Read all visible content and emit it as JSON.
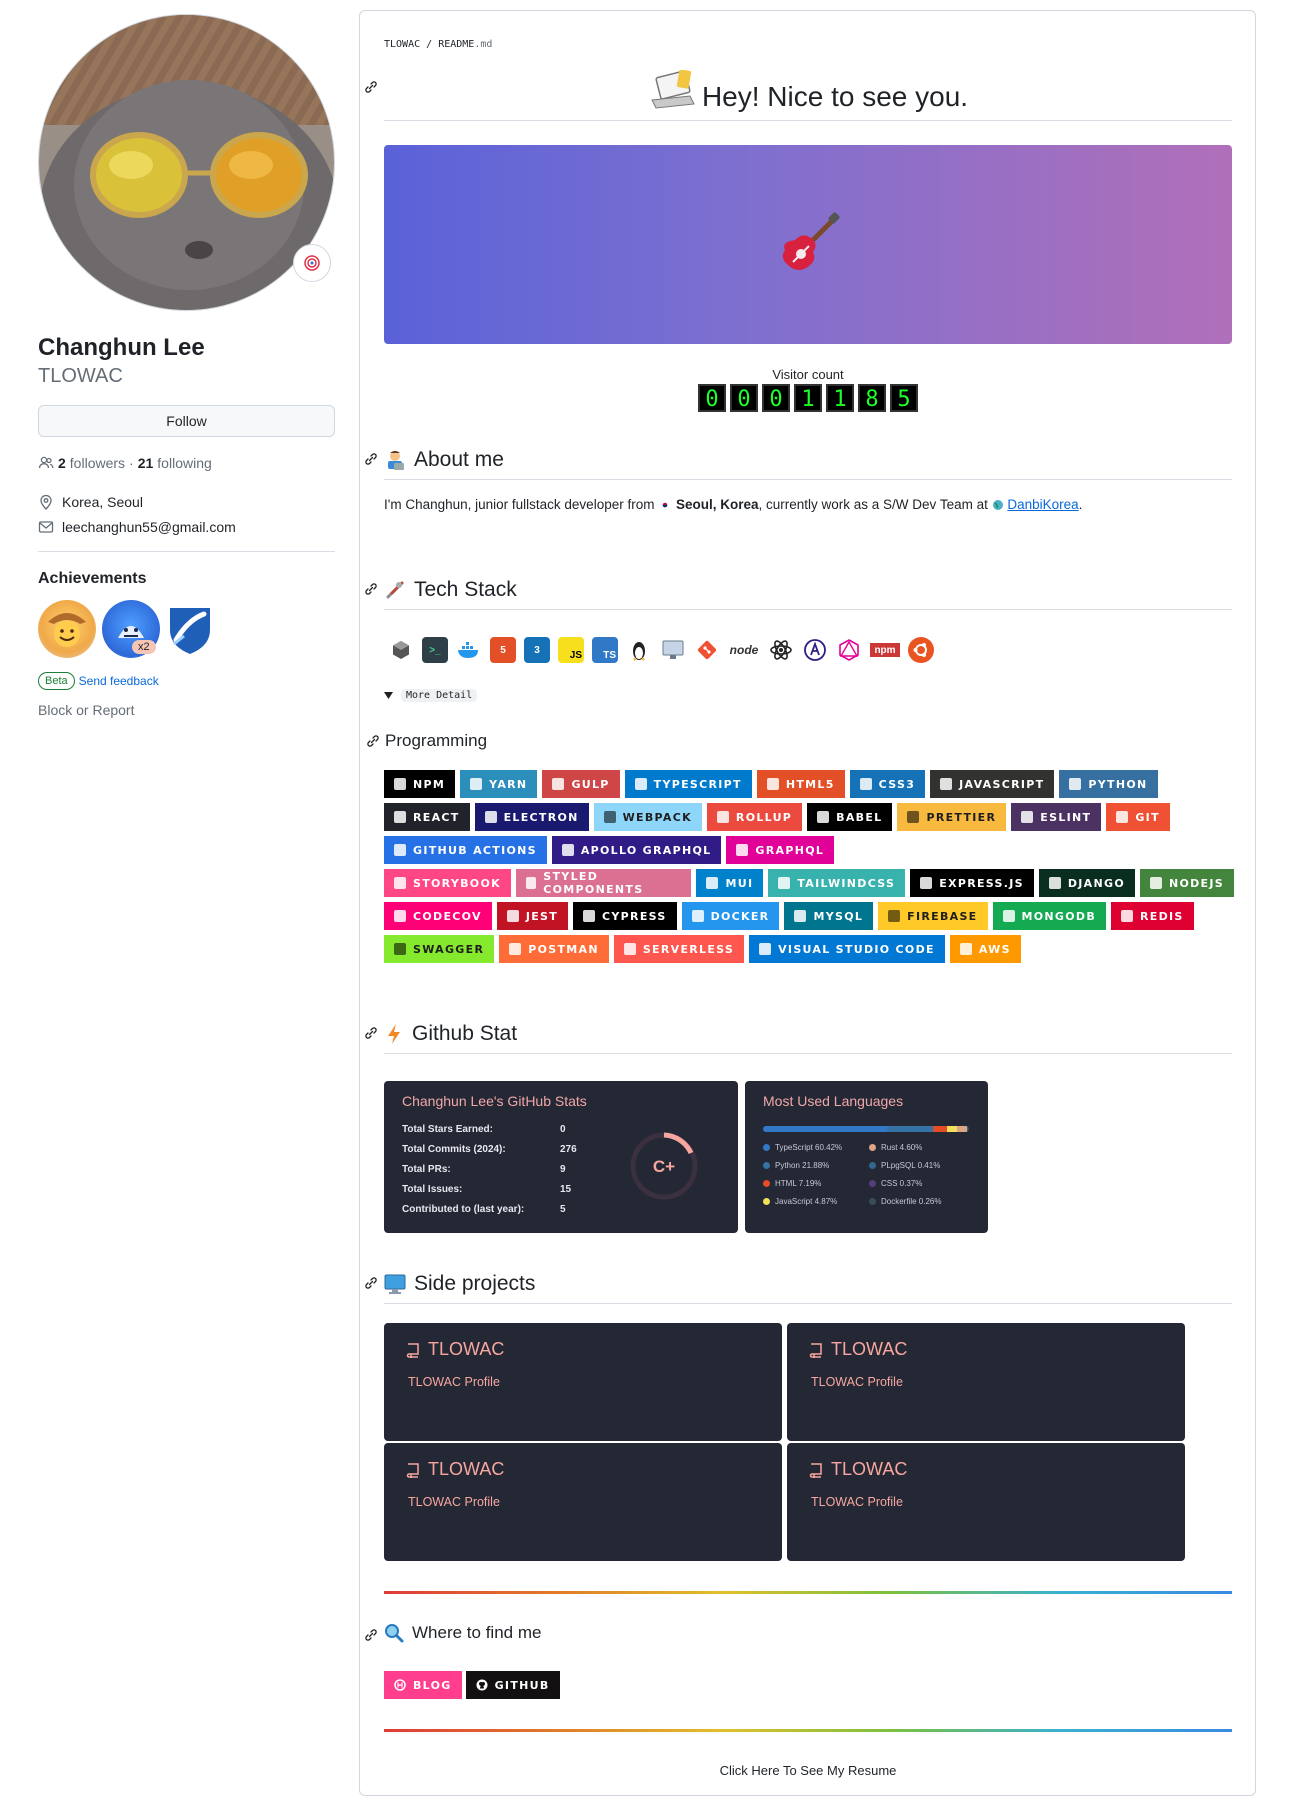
{
  "profile": {
    "fullname": "Changhun Lee",
    "username": "TLOWAC",
    "follow_label": "Follow",
    "followers_count": "2",
    "followers_label": "followers",
    "sep": "·",
    "following_count": "21",
    "following_label": "following",
    "location": "Korea, Seoul",
    "email": "leechanghun55@gmail.com",
    "achievements_title": "Achievements",
    "badge_multiplier": "x2",
    "beta_label": "Beta",
    "feedback_label": "Send feedback",
    "block_label": "Block or Report"
  },
  "readme": {
    "path_owner": "TLOWAC",
    "path_sep": " / ",
    "path_file": "README",
    "path_ext": ".md",
    "title": "Hey! Nice to see you.",
    "visitor_label": "Visitor count",
    "visitor_digits": [
      "0",
      "0",
      "0",
      "1",
      "1",
      "8",
      "5"
    ],
    "about_title": "About me",
    "about_pre": "I'm Changhun, junior fullstack developer from ",
    "about_city": "Seoul, Korea",
    "about_mid": ", currently work as a S/W Dev Team at ",
    "about_company": "DanbiKorea",
    "about_post": ".",
    "tech_title": "Tech Stack",
    "tech_icon_js": "JS",
    "tech_icon_ts": "TS",
    "tech_icon_node": "node",
    "tech_icon_npm": "npm",
    "details_label": "More Detail",
    "programming_title": "Programming",
    "shields": [
      [
        {
          "label": "NPM",
          "color": "#000000"
        },
        {
          "label": "YARN",
          "color": "#2c8ebb"
        },
        {
          "label": "GULP",
          "color": "#cf4647"
        },
        {
          "label": "TYPESCRIPT",
          "color": "#007acc"
        },
        {
          "label": "HTML5",
          "color": "#e34f26"
        },
        {
          "label": "CSS3",
          "color": "#1572b6"
        },
        {
          "label": "JAVASCRIPT",
          "color": "#323330"
        },
        {
          "label": "PYTHON",
          "color": "#3670a0"
        }
      ],
      [
        {
          "label": "REACT",
          "color": "#20232a"
        },
        {
          "label": "ELECTRON",
          "color": "#191970"
        },
        {
          "label": "WEBPACK",
          "color": "#8dd6f9"
        },
        {
          "label": "ROLLUP",
          "color": "#ec4a3f"
        },
        {
          "label": "BABEL",
          "color": "#000000"
        },
        {
          "label": "PRETTIER",
          "color": "#f7b93e"
        },
        {
          "label": "ESLINT",
          "color": "#4b3263"
        },
        {
          "label": "GIT",
          "color": "#f05033"
        }
      ],
      [
        {
          "label": "GITHUB ACTIONS",
          "color": "#2671e5"
        },
        {
          "label": "APOLLO GRAPHQL",
          "color": "#311c87"
        },
        {
          "label": "GRAPHQL",
          "color": "#e10098"
        }
      ],
      [
        {
          "label": "STORYBOOK",
          "color": "#ff4785"
        },
        {
          "label": "STYLED COMPONENTS",
          "color": "#db7093"
        },
        {
          "label": "MUI",
          "color": "#0081cb"
        },
        {
          "label": "TAILWINDCSS",
          "color": "#38b2ac"
        },
        {
          "label": "EXPRESS.JS",
          "color": "#000000"
        },
        {
          "label": "DJANGO",
          "color": "#092e20"
        },
        {
          "label": "NODEJS",
          "color": "#43853d"
        }
      ],
      [
        {
          "label": "CODECOV",
          "color": "#ff0077"
        },
        {
          "label": "JEST",
          "color": "#c21325"
        },
        {
          "label": "CYPRESS",
          "color": "#000000"
        },
        {
          "label": "DOCKER",
          "color": "#2496ed"
        },
        {
          "label": "MYSQL",
          "color": "#00758f"
        },
        {
          "label": "FIREBASE",
          "color": "#ffca28"
        },
        {
          "label": "MONGODB",
          "color": "#13aa52"
        },
        {
          "label": "REDIS",
          "color": "#dd0031"
        }
      ],
      [
        {
          "label": "SWAGGER",
          "color": "#85ea2d"
        },
        {
          "label": "POSTMAN",
          "color": "#ff6c37"
        },
        {
          "label": "SERVERLESS",
          "color": "#fd5750"
        },
        {
          "label": "VISUAL STUDIO CODE",
          "color": "#0078d4"
        },
        {
          "label": "AWS",
          "color": "#ff9900"
        }
      ]
    ],
    "github_stat_title": "Github Stat",
    "stats": {
      "title": "Changhun Lee's GitHub Stats",
      "rows": [
        {
          "label": "Total Stars Earned:",
          "value": "0"
        },
        {
          "label": "Total Commits (2024):",
          "value": "276"
        },
        {
          "label": "Total PRs:",
          "value": "9"
        },
        {
          "label": "Total Issues:",
          "value": "15"
        },
        {
          "label": "Contributed to (last year):",
          "value": "5"
        }
      ],
      "rank": "C+"
    },
    "languages": {
      "title": "Most Used Languages",
      "items": [
        {
          "name": "TypeScript 60.42%",
          "color": "#3178c6",
          "pct": 60.42
        },
        {
          "name": "Python 21.88%",
          "color": "#3572a5",
          "pct": 21.88
        },
        {
          "name": "HTML 7.19%",
          "color": "#e34c26",
          "pct": 7.19
        },
        {
          "name": "JavaScript 4.87%",
          "color": "#f1e05a",
          "pct": 4.87
        },
        {
          "name": "Rust 4.60%",
          "color": "#dea584",
          "pct": 4.6
        },
        {
          "name": "PLpgSQL 0.41%",
          "color": "#336790",
          "pct": 0.41
        },
        {
          "name": "CSS 0.37%",
          "color": "#563d7c",
          "pct": 0.37
        },
        {
          "name": "Dockerfile 0.26%",
          "color": "#384d54",
          "pct": 0.26
        }
      ]
    },
    "side_projects_title": "Side projects",
    "projects": [
      {
        "name": "TLOWAC",
        "desc": "TLOWAC Profile"
      },
      {
        "name": "TLOWAC",
        "desc": "TLOWAC Profile"
      },
      {
        "name": "TLOWAC",
        "desc": "TLOWAC Profile"
      },
      {
        "name": "TLOWAC",
        "desc": "TLOWAC Profile"
      }
    ],
    "find_title": "Where to find me",
    "find_links": [
      {
        "label": "BLOG",
        "color": "#ff3f8e"
      },
      {
        "label": "GITHUB",
        "color": "#121011"
      }
    ],
    "resume_label": "Click Here To See My Resume"
  }
}
